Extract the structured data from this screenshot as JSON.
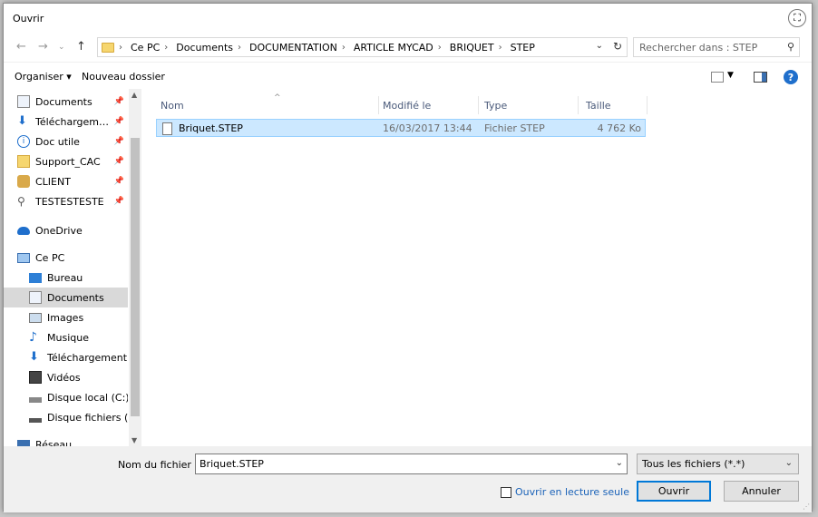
{
  "window": {
    "title": "Ouvrir"
  },
  "address": {
    "crumbs": [
      "Ce PC",
      "Documents",
      "DOCUMENTATION",
      "ARTICLE MYCAD",
      "BRIQUET",
      "STEP"
    ],
    "search_placeholder": "Rechercher dans : STEP"
  },
  "toolbar": {
    "organize": "Organiser ▾",
    "new_folder": "Nouveau dossier"
  },
  "nav": {
    "items": [
      {
        "label": "Documents",
        "pinned": true
      },
      {
        "label": "Téléchargem…",
        "pinned": true
      },
      {
        "label": "Doc utile",
        "pinned": true
      },
      {
        "label": "Support_CAC",
        "pinned": true
      },
      {
        "label": "CLIENT",
        "pinned": true
      },
      {
        "label": "TESTESTESTE",
        "pinned": true
      },
      {
        "label": "OneDrive"
      },
      {
        "label": "Ce PC"
      },
      {
        "label": "Bureau"
      },
      {
        "label": "Documents",
        "selected": true
      },
      {
        "label": "Images"
      },
      {
        "label": "Musique"
      },
      {
        "label": "Téléchargement"
      },
      {
        "label": "Vidéos"
      },
      {
        "label": "Disque local (C:)"
      },
      {
        "label": "Disque fichiers (I"
      },
      {
        "label": "Réseau"
      }
    ]
  },
  "files": {
    "columns": [
      "Nom",
      "Modifié le",
      "Type",
      "Taille"
    ],
    "rows": [
      {
        "name": "Briquet.STEP",
        "modified": "16/03/2017 13:44",
        "type": "Fichier STEP",
        "size": "4 762 Ko"
      }
    ]
  },
  "bottom": {
    "filename_label": "Nom du fichier :",
    "filename_value": "Briquet.STEP",
    "filter": "Tous les fichiers (*.*)",
    "readonly_label": "Ouvrir en lecture seule",
    "open_label": "Ouvrir",
    "cancel_label": "Annuler"
  },
  "colors": {
    "selection": "#cce8ff",
    "accent": "#0078d7"
  }
}
